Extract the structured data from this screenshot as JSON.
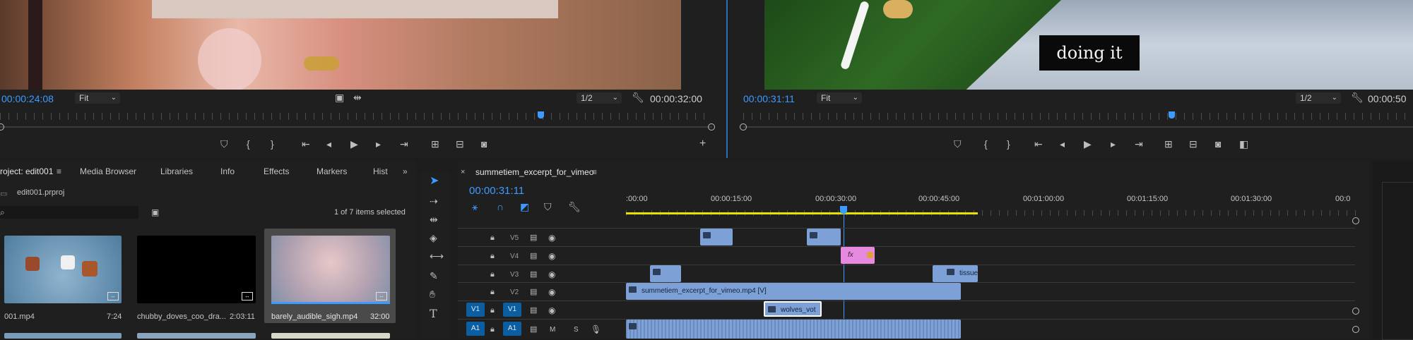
{
  "source_monitor": {
    "timecode_current": "00:00:24:08",
    "zoom": "Fit",
    "resolution": "1/2",
    "timecode_duration": "00:00:32:00"
  },
  "program_monitor": {
    "timecode_current": "00:00:31:11",
    "zoom": "Fit",
    "resolution": "1/2",
    "timecode_duration": "00:00:50",
    "title_overlay": "doing it"
  },
  "project_panel": {
    "tabs": [
      "roject: edit001",
      "Media Browser",
      "Libraries",
      "Info",
      "Effects",
      "Markers",
      "Hist"
    ],
    "file_name": "edit001.prproj",
    "search_placeholder": "",
    "selection_status": "1 of 7 items selected",
    "items": [
      {
        "name": "001.mp4",
        "duration": "7:24"
      },
      {
        "name": "chubby_doves_coo_dra...",
        "duration": "2:03:11"
      },
      {
        "name": "barely_audible_sigh.mp4",
        "duration": "32:00"
      }
    ]
  },
  "timeline": {
    "sequence_name": "summetiem_excerpt_for_vimeo",
    "timecode": "00:00:31:11",
    "ruler_labels": [
      ":00:00",
      "00:00:15:00",
      "00:00:30:00",
      "00:00:45:00",
      "00:01:00:00",
      "00:01:15:00",
      "00:01:30:00",
      "00:0"
    ],
    "tracks": [
      {
        "name": "V5"
      },
      {
        "name": "V4"
      },
      {
        "name": "V3"
      },
      {
        "name": "V2"
      },
      {
        "name": "V1",
        "source": "V1"
      },
      {
        "name": "A1",
        "source": "A1",
        "mute": "M",
        "solo": "S"
      }
    ],
    "clips": {
      "v3_tissue": "tissue",
      "v2_main": "summetiem_excerpt_for_vimeo.mp4 [V]",
      "v1_wolves": "wolves_vot",
      "v4_fx": "fx"
    }
  },
  "colors": {
    "accent_blue": "#3d9bff",
    "clip_blue": "#7da0d6",
    "clip_pink": "#e68ae0",
    "work_area_yellow": "#e8e000"
  }
}
